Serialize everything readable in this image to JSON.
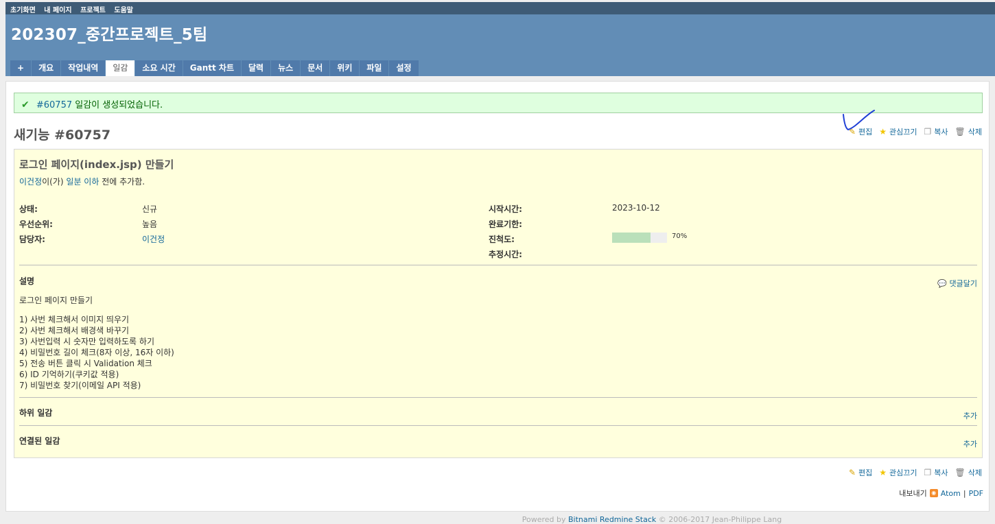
{
  "top_menu": [
    "초기화면",
    "내 페이지",
    "프로젝트",
    "도움말"
  ],
  "project_title": "202307_중간프로젝트_5팀",
  "tabs": [
    "+",
    "개요",
    "작업내역",
    "일감",
    "소요 시간",
    "Gantt 차트",
    "달력",
    "뉴스",
    "문서",
    "위키",
    "파일",
    "설정"
  ],
  "selected_tab": "일감",
  "flash": {
    "link": "#60757",
    "message": "일감이 생성되었습니다."
  },
  "issue_heading": "새기능 #60757",
  "actions": {
    "edit": "편집",
    "watch": "관심끄기",
    "copy": "복사",
    "delete": "삭제"
  },
  "issue": {
    "subject": "로그인 페이지(index.jsp) 만들기",
    "author_link": "이건정",
    "author_mid": "이(가)",
    "time_link": "일분 이하",
    "author_end": "전에 추가함."
  },
  "attributes": {
    "status_label": "상태:",
    "status_value": "신규",
    "priority_label": "우선순위:",
    "priority_value": "높음",
    "assignee_label": "담당자:",
    "assignee_value": "이건정",
    "start_label": "시작시간:",
    "start_value": "2023-10-12",
    "due_label": "완료기한:",
    "due_value": "",
    "progress_label": "진척도:",
    "progress_value": "70%",
    "progress_fraction": 0.7,
    "estimate_label": "추정시간:",
    "estimate_value": ""
  },
  "description": {
    "title": "설명",
    "quote_label": "댓글달기",
    "first_line": "로그인 페이지 만들기",
    "lines": [
      "1) 사번 체크해서 이미지 띄우기",
      "2) 사번 체크해서 배경색 바꾸기",
      "3) 사번입력 시 숫자만 입력하도록 하기",
      "4) 비밀번호 길이 체크(8자 이상, 16자 이하)",
      "5) 전송 버튼 클릭 시 Validation 체크",
      "6) ID 기억하기(쿠키값 적용)",
      "7) 비밀번호 찾기(이메일 API 적용)"
    ]
  },
  "subtasks": {
    "title": "하위 일감",
    "add": "추가"
  },
  "relations": {
    "title": "연결된 일감",
    "add": "추가"
  },
  "export": {
    "label": "내보내기",
    "atom": "Atom",
    "sep": "|",
    "pdf": "PDF"
  },
  "footer": {
    "prefix": "Powered by",
    "link": "Bitnami Redmine Stack",
    "suffix": "© 2006-2017 Jean-Philippe Lang"
  },
  "colors": {
    "header": "#628db6",
    "top_menu": "#3e5b76",
    "tab": "#507aaa",
    "issue_bg": "#ffffdd",
    "flash_bg": "#dfffdf",
    "progress_fill": "#bae0ba"
  }
}
